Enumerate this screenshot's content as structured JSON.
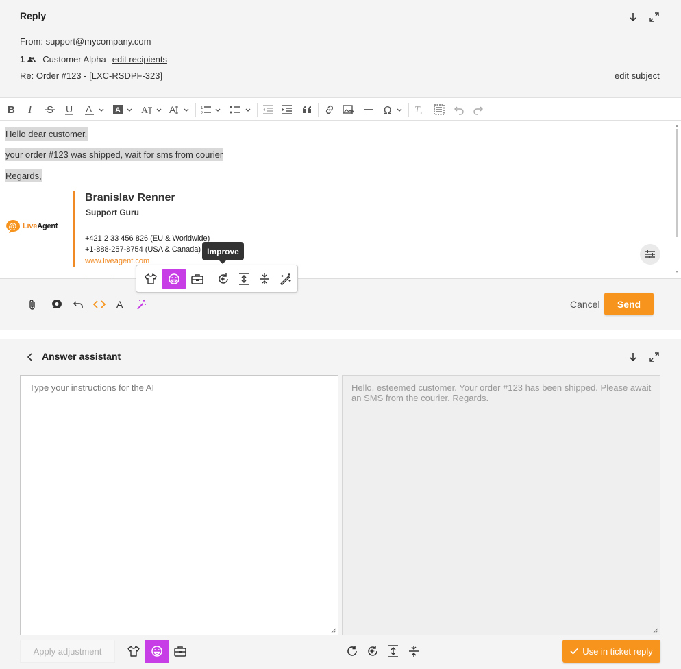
{
  "reply": {
    "title": "Reply",
    "from_label": "From:",
    "from_value": "support@mycompany.com",
    "recipients_count": "1",
    "recipient_name": "Customer Alpha",
    "edit_recipients": "edit recipients",
    "subject": "Re: Order #123 - [LXC-RSDPF-323]",
    "edit_subject": "edit subject"
  },
  "editor": {
    "lines": [
      "Hello dear customer,",
      "your order #123 was shipped, wait for sms from courier",
      "Regards,"
    ],
    "signature": {
      "logo_at": "@",
      "logo_live": "Live",
      "logo_agent": "Agent",
      "name": "Branislav Renner",
      "role": "Support Guru",
      "phone_eu": "+421 2 33 456 826 (EU & Worldwide)",
      "phone_us": "+1-888-257-8754 (USA & Canada)",
      "website": "www.liveagent.com"
    }
  },
  "ai_popup": {
    "tooltip": "Improve",
    "icons": [
      "tshirt-icon",
      "smile-icon",
      "briefcase-icon",
      "improve-icon",
      "expand-icon",
      "shorten-icon",
      "magic-wand-icon"
    ]
  },
  "actions": {
    "cancel": "Cancel",
    "send": "Send"
  },
  "assistant": {
    "title": "Answer assistant",
    "instructions_placeholder": "Type your instructions for the AI",
    "result_text": "Hello, esteemed customer. Your order #123 has been shipped. Please await an SMS from the courier. Regards.",
    "apply_label": "Apply adjustment",
    "use_label": "Use in ticket reply"
  },
  "colors": {
    "accent_orange": "#f7941d",
    "active_purple": "#c83ee6"
  }
}
